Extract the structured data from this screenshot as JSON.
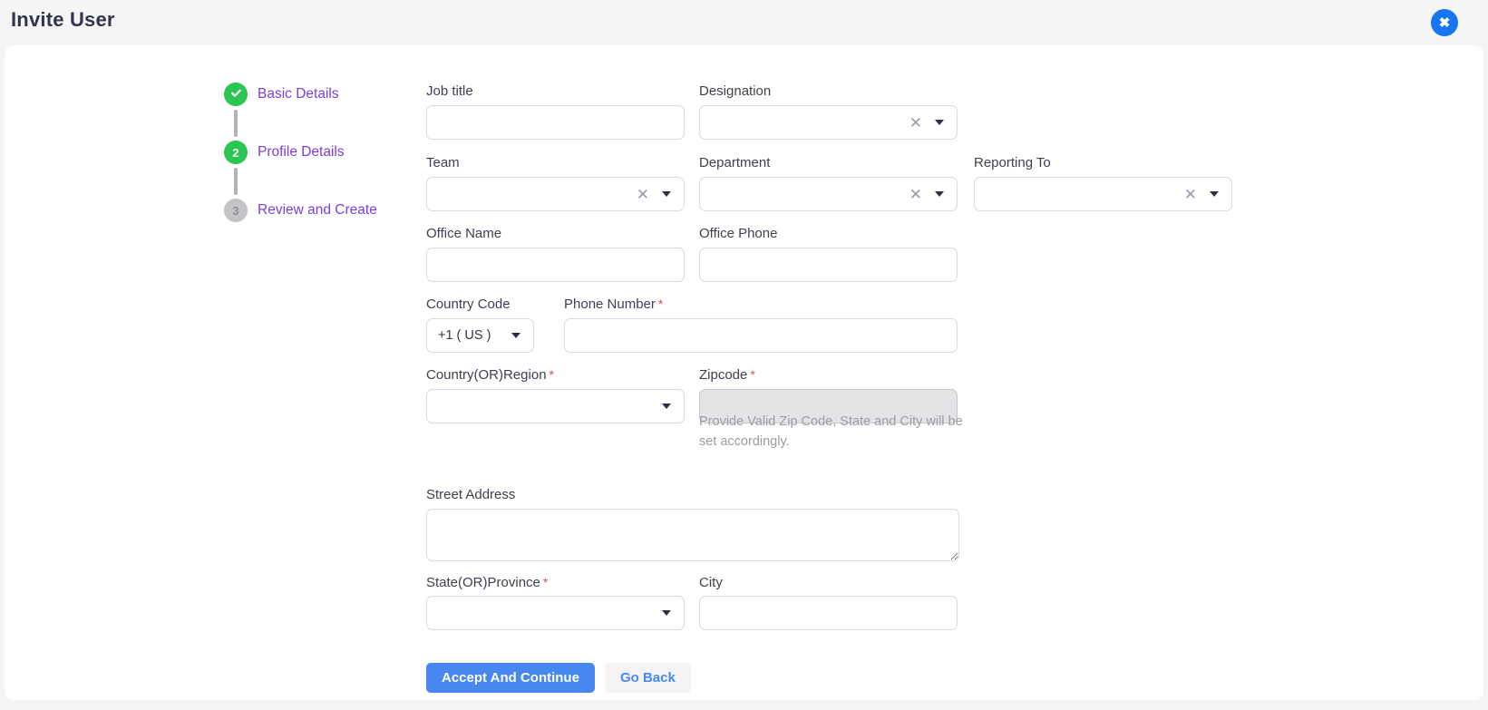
{
  "header": {
    "title": "Invite User"
  },
  "stepper": {
    "steps": [
      {
        "label": "Basic Details",
        "status": "completed",
        "indicator": "check"
      },
      {
        "label": "Profile Details",
        "status": "active",
        "indicator": "2"
      },
      {
        "label": "Review and Create",
        "status": "pending",
        "indicator": "3"
      }
    ]
  },
  "form": {
    "required_marker": "*",
    "fields": {
      "job_title": {
        "label": "Job title",
        "value": ""
      },
      "designation": {
        "label": "Designation",
        "value": ""
      },
      "team": {
        "label": "Team",
        "value": ""
      },
      "department": {
        "label": "Department",
        "value": ""
      },
      "reporting_to": {
        "label": "Reporting To",
        "value": ""
      },
      "office_name": {
        "label": "Office Name",
        "value": ""
      },
      "office_phone": {
        "label": "Office Phone",
        "value": ""
      },
      "country_code": {
        "label": "Country Code",
        "value": "+1 ( US )"
      },
      "phone_number": {
        "label": "Phone Number",
        "value": "",
        "required": true
      },
      "country_region": {
        "label": "Country(OR)Region",
        "value": "",
        "required": true
      },
      "zipcode": {
        "label": "Zipcode",
        "value": "",
        "required": true,
        "disabled": true,
        "helper": "Provide Valid Zip Code, State and City will be set accordingly."
      },
      "street_address": {
        "label": "Street Address",
        "value": ""
      },
      "state_province": {
        "label": "State(OR)Province",
        "value": "",
        "required": true
      },
      "city": {
        "label": "City",
        "value": ""
      }
    },
    "buttons": {
      "accept": "Accept And Continue",
      "go_back": "Go Back"
    }
  },
  "icons": {
    "close": "close-icon",
    "clear": "clear-x-icon",
    "dropdown": "chevron-down-icon",
    "step_done": "check-icon"
  },
  "colors": {
    "accent_blue": "#4687f0",
    "close_blue": "#1976f2",
    "step_green": "#2bc553",
    "step_purple": "#7d3ce0",
    "required_red": "#e5484d",
    "header_bg": "#f5f5f6",
    "disabled_bg": "#e4e4e6"
  }
}
